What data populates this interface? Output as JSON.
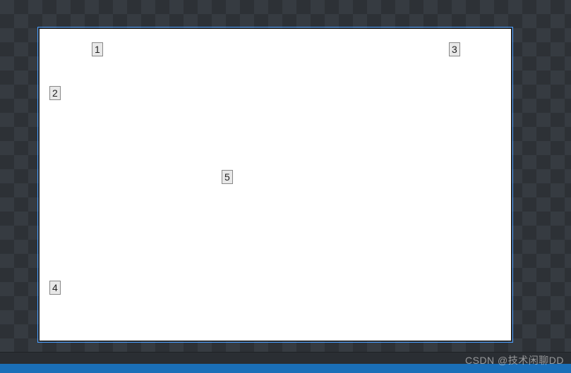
{
  "canvas": {
    "markers": {
      "m1": "1",
      "m2": "2",
      "m3": "3",
      "m4": "4",
      "m5": "5"
    }
  },
  "watermark": "CSDN @技术闲聊DD"
}
